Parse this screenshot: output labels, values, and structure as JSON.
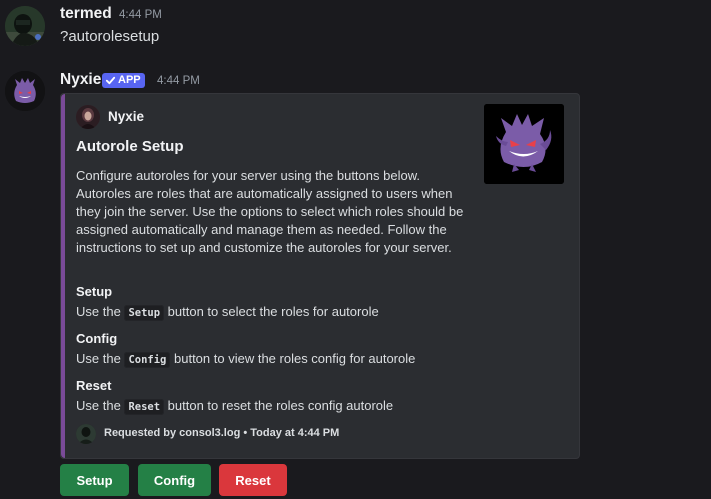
{
  "messages": [
    {
      "username": "termed",
      "timestamp": "4:44 PM",
      "content": "?autorolesetup"
    },
    {
      "username": "Nyxie",
      "badge": "APP",
      "timestamp": "4:44 PM"
    }
  ],
  "embed": {
    "accent_color": "#7a4b98",
    "author": "Nyxie",
    "title": "Autorole Setup",
    "description": "Configure autoroles for your server using the buttons below. Autoroles are roles that are automatically assigned to users when they join the server. Use the options to select which roles should be assigned automatically and manage them as needed. Follow the instructions to set up and customize the autoroles for your server.",
    "fields": [
      {
        "name": "Setup",
        "prefix": "Use the",
        "code": "Setup",
        "suffix": "button to select the roles for autorole"
      },
      {
        "name": "Config",
        "prefix": "Use the",
        "code": "Config",
        "suffix": "button to view the roles config for autorole"
      },
      {
        "name": "Reset",
        "prefix": "Use the",
        "code": "Reset",
        "suffix": "button to reset the roles config autorole"
      }
    ],
    "footer": "Requested by consol3.log • Today at 4:44 PM",
    "thumbnail_icon": "gengar-icon"
  },
  "buttons": [
    {
      "label": "Setup",
      "color": "#248046"
    },
    {
      "label": "Config",
      "color": "#248046"
    },
    {
      "label": "Reset",
      "color": "#da373c"
    }
  ],
  "colors": {
    "background": "#1a1a1e",
    "embed_background": "#2b2d31",
    "app_badge": "#5865f2"
  }
}
